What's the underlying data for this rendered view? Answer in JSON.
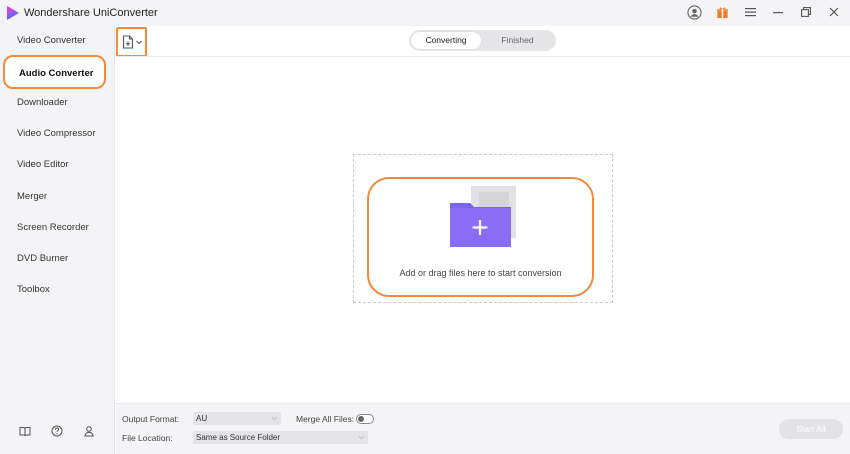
{
  "app": {
    "title": "Wondershare UniConverter",
    "accent_color": "#f28a3c",
    "logo_colors": [
      "#7b5cf5",
      "#c34bd8"
    ]
  },
  "titlebar": {
    "icons": [
      "user-icon",
      "gift-icon",
      "menu-icon",
      "minimize-icon",
      "restore-icon",
      "close-icon"
    ]
  },
  "sidebar": {
    "items": [
      {
        "label": "Video Converter"
      },
      {
        "label": "Audio Converter",
        "active": true
      },
      {
        "label": "Downloader"
      },
      {
        "label": "Video Compressor"
      },
      {
        "label": "Video Editor"
      },
      {
        "label": "Merger"
      },
      {
        "label": "Screen Recorder"
      },
      {
        "label": "DVD Burner"
      },
      {
        "label": "Toolbox"
      }
    ],
    "bottom_icons": [
      "book-icon",
      "help-icon",
      "account-icon"
    ]
  },
  "header": {
    "add_files_icon": "add-file-icon",
    "tabs": [
      {
        "label": "Converting",
        "active": true
      },
      {
        "label": "Finished"
      }
    ]
  },
  "dropzone": {
    "text": "Add or drag files here to start conversion",
    "folder_color": "#7b63f0"
  },
  "bottom": {
    "output_format_label": "Output Format:",
    "output_format_value": "AU",
    "merge_label": "Merge All Files:",
    "merge_enabled": false,
    "file_location_label": "File Location:",
    "file_location_value": "Same as Source Folder",
    "start_all_label": "Start All"
  }
}
